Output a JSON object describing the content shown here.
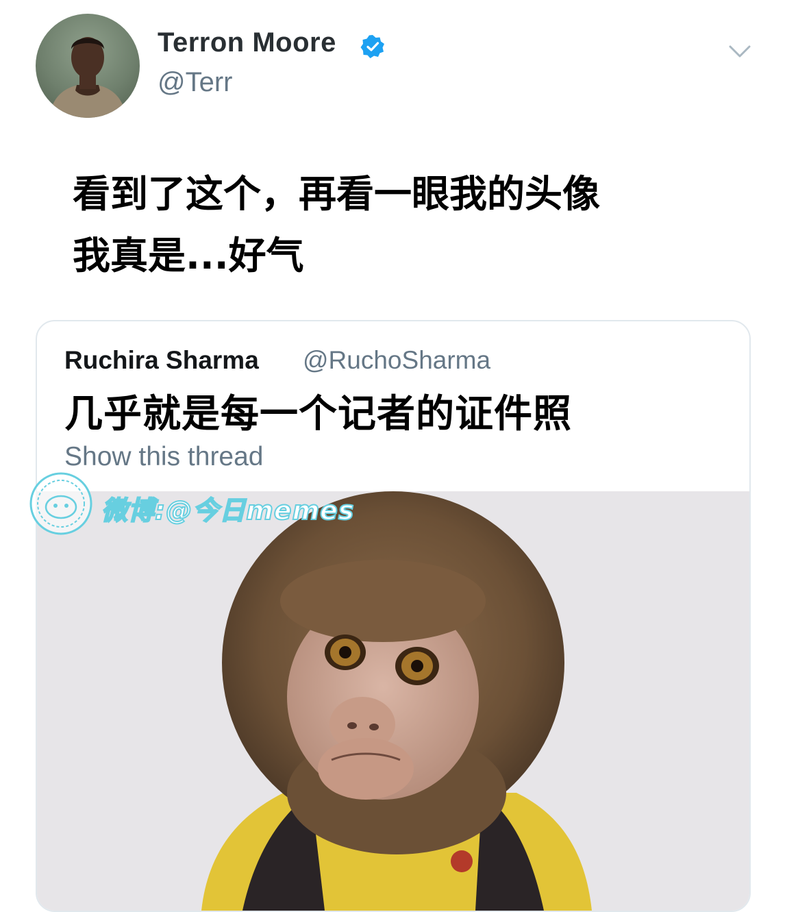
{
  "tweet": {
    "author_name": "Terron Moore",
    "author_handle": "@Terr",
    "text": "看到了这个，再看一眼我的头像\n我真是...好气"
  },
  "quoted_tweet": {
    "author_name": "Ruchira Sharma",
    "author_handle": "@RuchoSharma",
    "text": "几乎就是每一个记者的证件照",
    "show_thread_label": "Show this thread"
  },
  "watermark": {
    "text": "微博:@今日memes"
  },
  "colors": {
    "verified_blue": "#1da1f2",
    "secondary_text": "#657786",
    "card_border": "#e1e8ed",
    "watermark_cyan": "#67cfe0"
  },
  "icons": {
    "verified": "verified-badge-icon",
    "more": "chevron-down-icon",
    "watermark_logo": "watermark-logo-icon"
  }
}
